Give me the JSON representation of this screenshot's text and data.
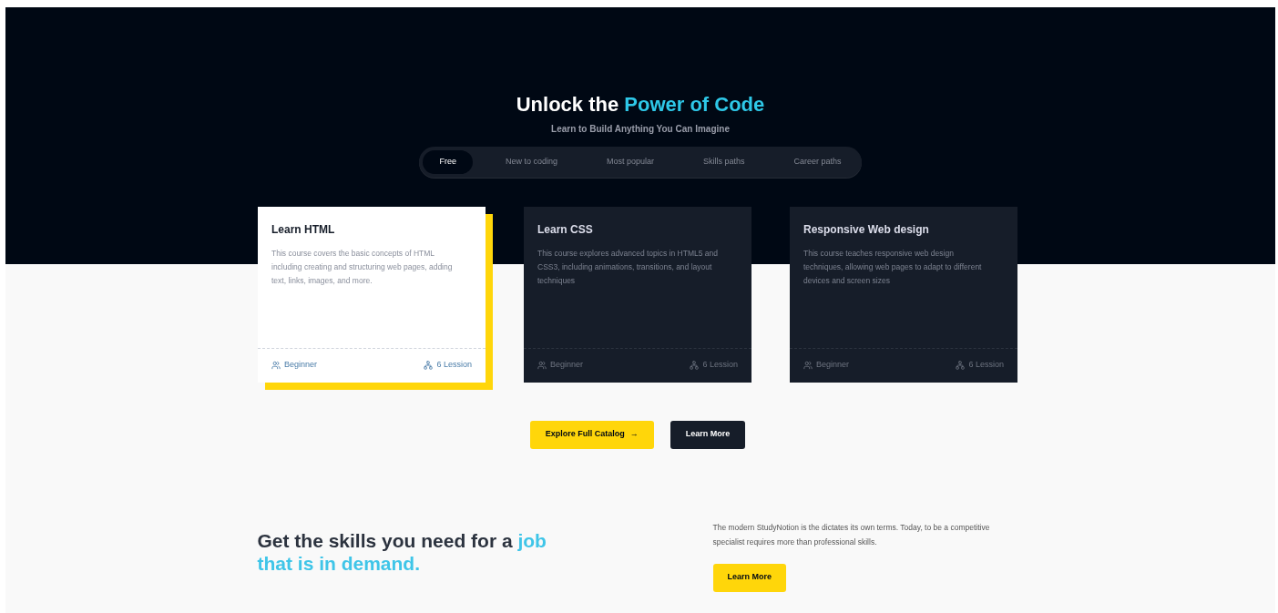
{
  "hero": {
    "title_prefix": "Unlock the ",
    "title_highlight": "Power of Code",
    "subtitle": "Learn to Build Anything You Can Imagine"
  },
  "tabs": [
    {
      "label": "Free",
      "selected": true
    },
    {
      "label": "New to coding",
      "selected": false
    },
    {
      "label": "Most popular",
      "selected": false
    },
    {
      "label": "Skills paths",
      "selected": false
    },
    {
      "label": "Career paths",
      "selected": false
    }
  ],
  "courses": [
    {
      "title": "Learn HTML",
      "description": "This course covers the basic concepts of HTML including creating and structuring web pages, adding text, links, images, and more.",
      "level": "Beginner",
      "lessons": "6 Lession",
      "selected": true
    },
    {
      "title": "Learn CSS",
      "description": "This course explores advanced topics in HTML5 and CSS3, including animations, transitions, and layout techniques",
      "level": "Beginner",
      "lessons": "6 Lession",
      "selected": false
    },
    {
      "title": "Responsive Web design",
      "description": "This course teaches responsive web design techniques, allowing web pages to adapt to different devices and screen sizes",
      "level": "Beginner",
      "lessons": "6 Lession",
      "selected": false
    }
  ],
  "actions": [
    {
      "label": "Explore Full Catalog",
      "arrow": "→",
      "kind": "primary"
    },
    {
      "label": "Learn More",
      "kind": "secondary"
    }
  ],
  "skills": {
    "heading_prefix": "Get the skills you need for a ",
    "heading_highlight": "job that is in demand.",
    "text": "The modern StudyNotion is the dictates its own terms. Today, to be a competitive specialist requires more than professional skills.",
    "button": "Learn More"
  }
}
